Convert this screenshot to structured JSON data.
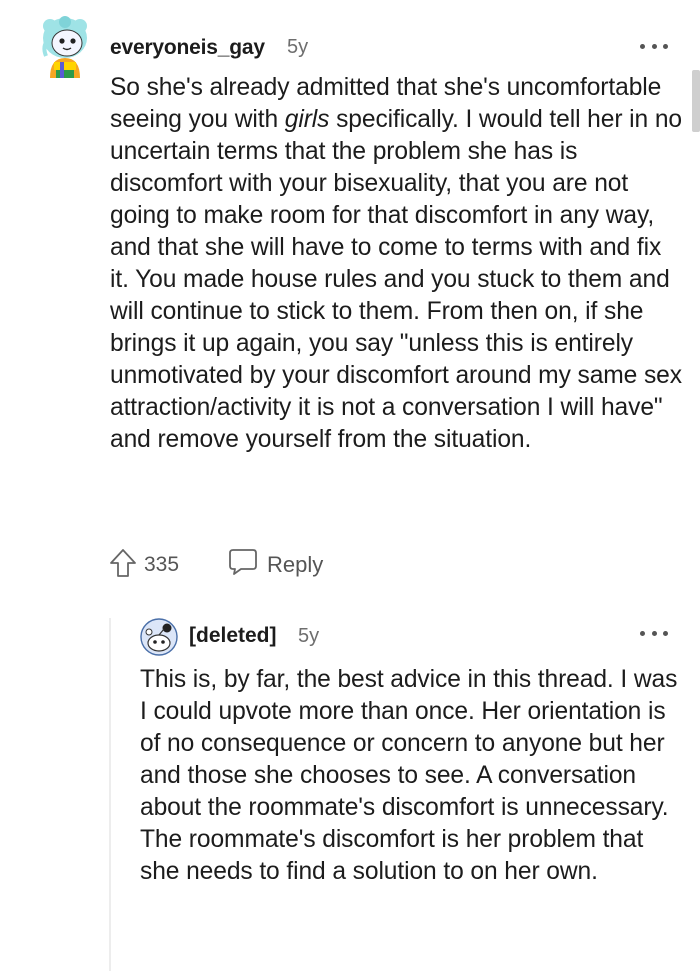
{
  "comment": {
    "username": "everyoneis_gay",
    "age": "5y",
    "text_part1": "So she's already admitted that she's uncomfortable seeing you with ",
    "text_emphasis": "girls",
    "text_part2": " specifically. I would tell her in no uncertain terms that the problem she has is discomfort with your bisexuality, that you are not going to make room for that discomfort in any way, and that she will have to come to terms with and fix it. You made house rules and you stuck to them and will continue to stick to them. From then on, if she brings it up again, you say \"unless this is entirely unmotivated by your discomfort around my same sex attraction/activity it is not a conversation I will have\" and remove yourself from the situation.",
    "upvotes": "335",
    "reply_label": "Reply",
    "avatar_icon": "snoo-avatar-icon",
    "more_icon": "more-options-icon"
  },
  "reply": {
    "username": "[deleted]",
    "age": "5y",
    "text": "This is, by far, the best advice in this thread. I was I could upvote more than once. Her orientation is of no consequence or concern to anyone but her and those she chooses to see. A conversation about the roommate's discomfort is unnecessary. The roommate's discomfort is her problem that she needs to find a solution to on her own.",
    "avatar_icon": "deleted-user-avatar-icon",
    "more_icon": "more-options-icon"
  },
  "colors": {
    "text": "#1c1c1c",
    "meta": "#6e6e6e",
    "action": "#555555",
    "thread_line": "#ededed"
  }
}
